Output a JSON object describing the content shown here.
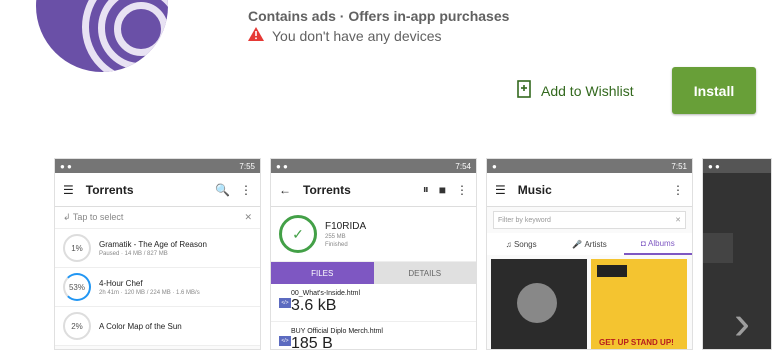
{
  "header": {
    "meta": "Contains ads · Offers in-app purchases",
    "warning": "You don't have any devices",
    "wishlist_label": "Add to Wishlist",
    "install_label": "Install"
  },
  "shot1": {
    "time": "7:55",
    "title": "Torrents",
    "tap_select": "Tap to select",
    "items": [
      {
        "progress": "1%",
        "name": "Gramatik - The Age of Reason",
        "sub": "Paused · 14 MB / 827 MB"
      },
      {
        "progress": "53%",
        "name": "4-Hour Chef",
        "sub": "2h 41m · 120 MB / 224 MB · 1.6 MB/s"
      },
      {
        "progress": "2%",
        "name": "A Color Map of the Sun",
        "sub": ""
      }
    ]
  },
  "shot2": {
    "time": "7:54",
    "title": "Torrents",
    "name": "F10RIDA",
    "size": "255 MB",
    "status": "Finished",
    "tab_files": "FILES",
    "tab_details": "DETAILS",
    "files": [
      {
        "name": "00_What's-Inside.html",
        "size": "3.6 kB"
      },
      {
        "name": "BUY Official Diplo Merch.html",
        "size": "185 B"
      }
    ]
  },
  "shot3": {
    "time": "7:51",
    "title": "Music",
    "filter_placeholder": "Filter by keyword",
    "tab_songs": "Songs",
    "tab_artists": "Artists",
    "tab_albums": "Albums",
    "album2_text": "GET UP STAND UP!"
  }
}
